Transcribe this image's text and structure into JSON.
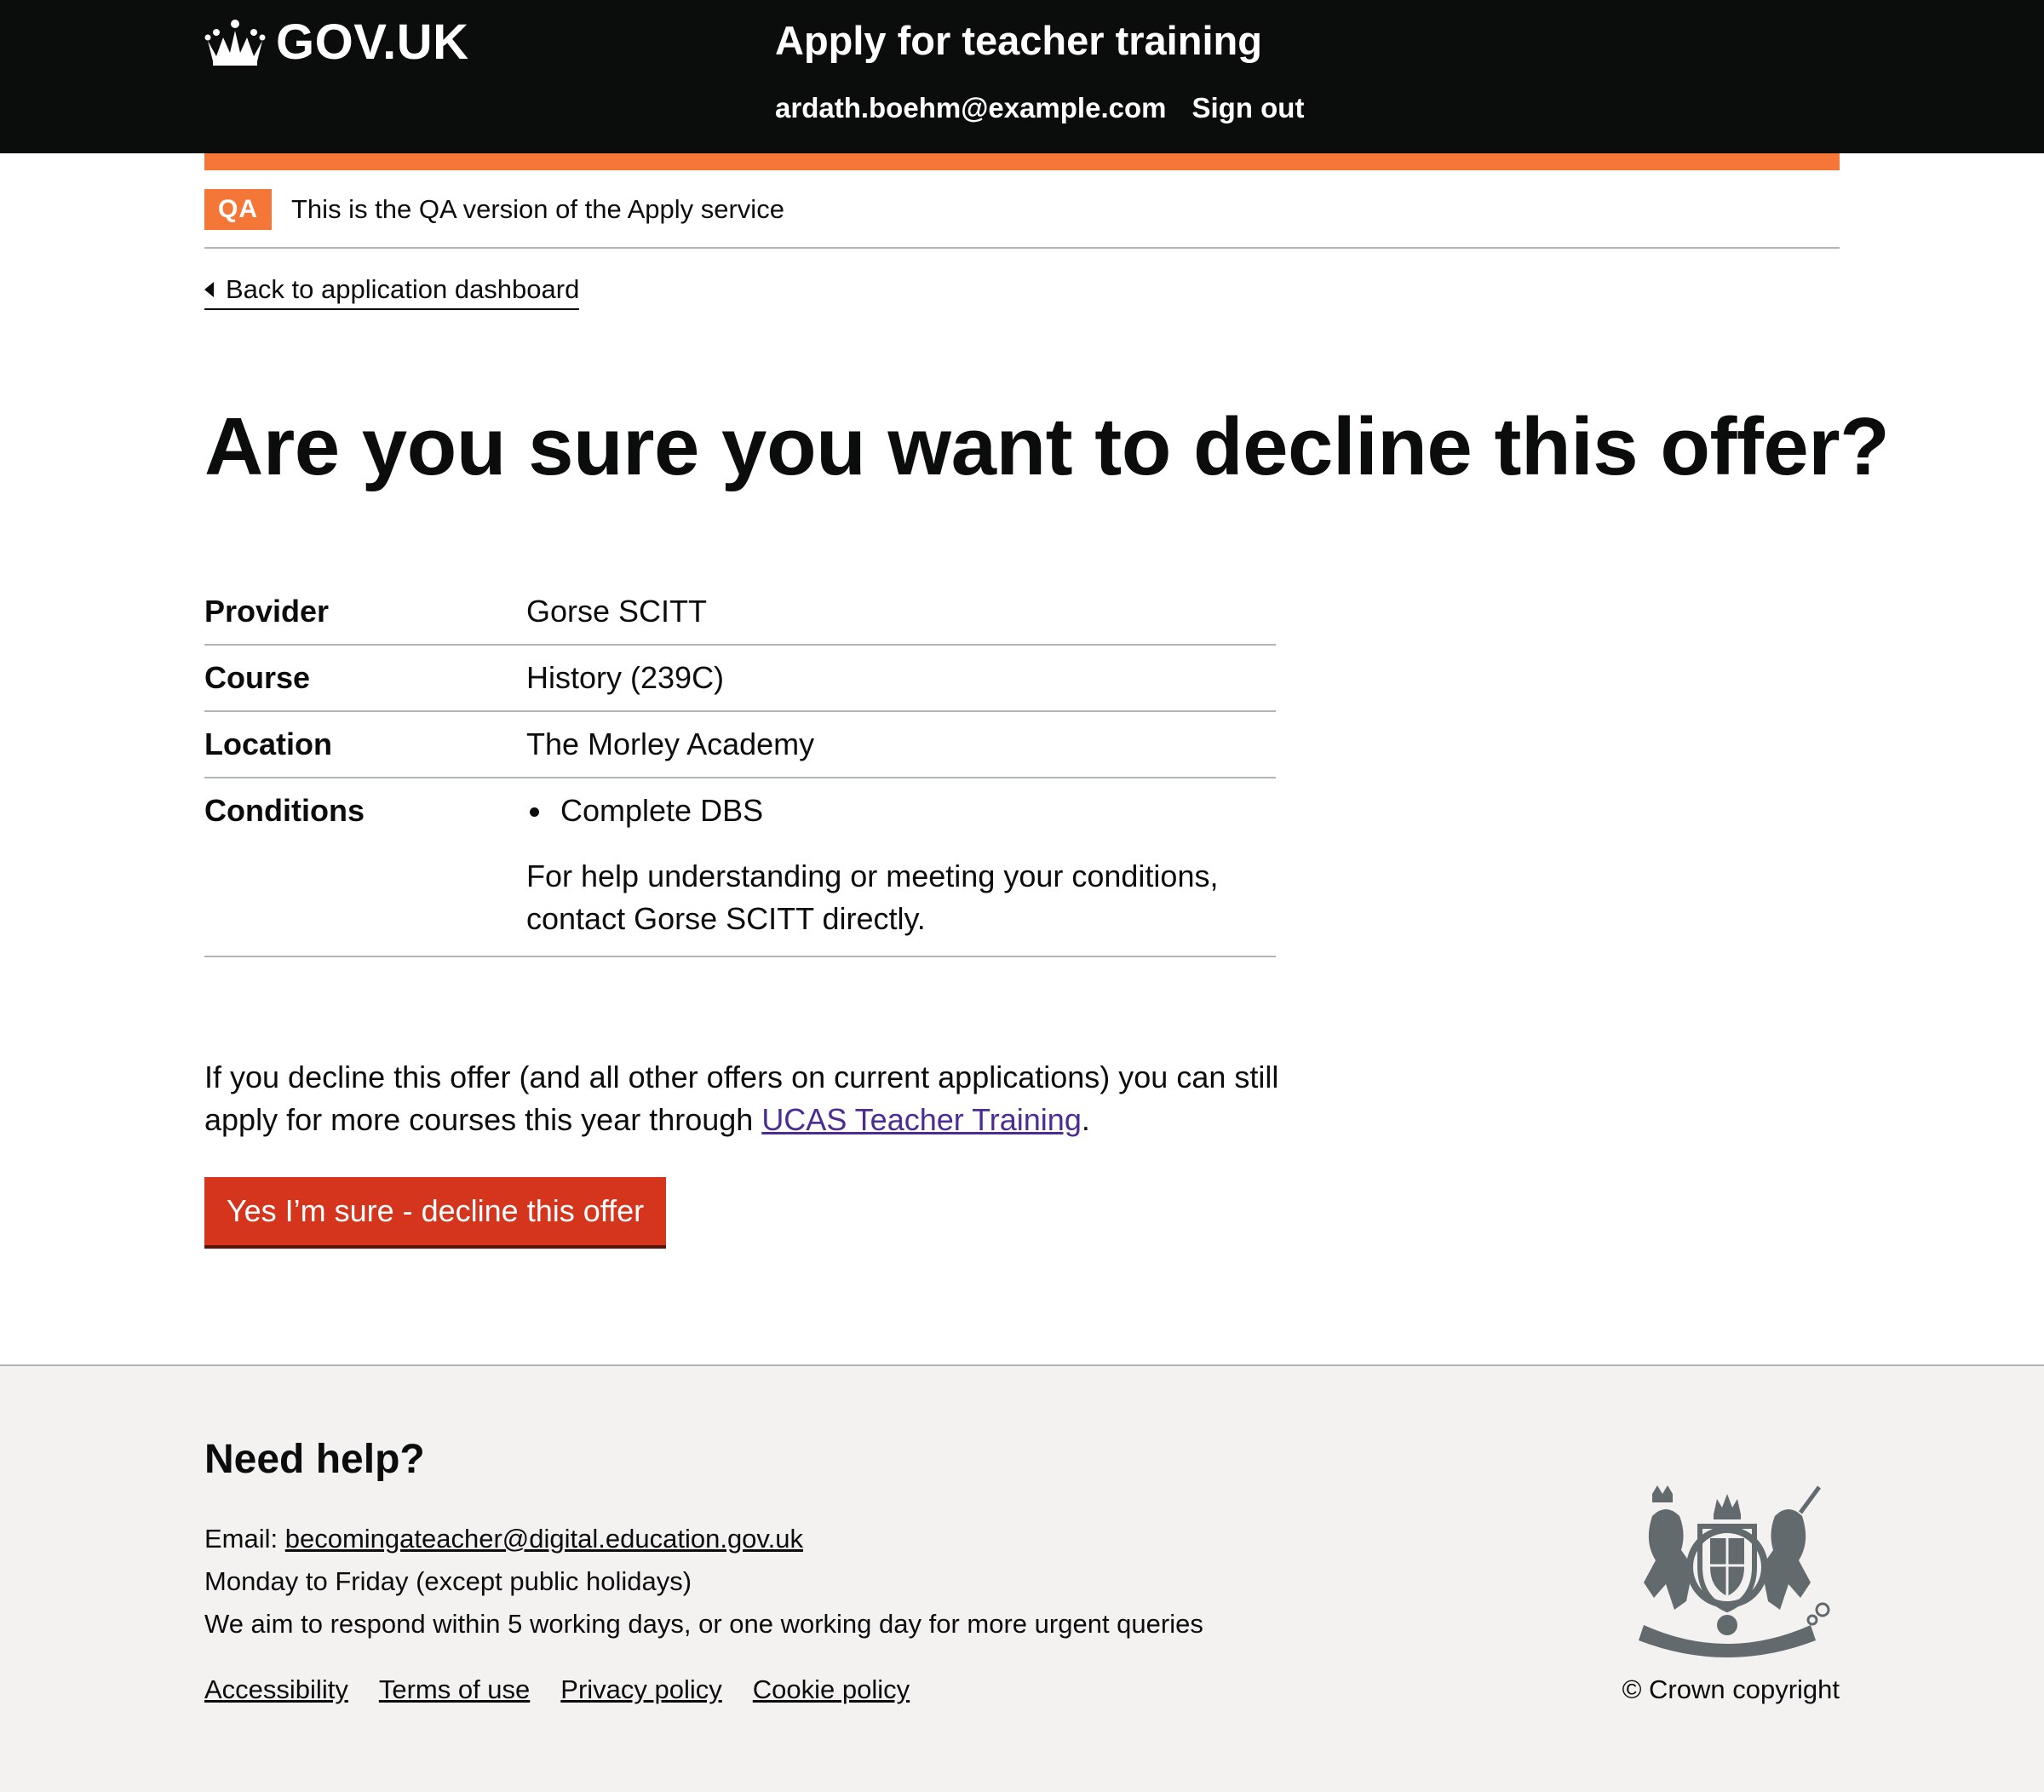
{
  "header": {
    "logo_text": "GOV.UK",
    "service_name": "Apply for teacher training",
    "user_email": "ardath.boehm@example.com",
    "sign_out": "Sign out"
  },
  "phase_banner": {
    "tag": "QA",
    "text": "This is the QA version of the Apply service"
  },
  "back_link": "Back to application dashboard",
  "heading": "Are you sure you want to decline this offer?",
  "summary": {
    "provider_key": "Provider",
    "provider_value": "Gorse SCITT",
    "course_key": "Course",
    "course_value": "History (239C)",
    "location_key": "Location",
    "location_value": "The Morley Academy",
    "conditions_key": "Conditions",
    "conditions_items": [
      "Complete DBS"
    ],
    "conditions_help": "For help understanding or meeting your conditions, contact Gorse SCITT directly."
  },
  "paragraph": {
    "text_before": "If you decline this offer (and all other offers on current applications) you can still apply for more courses this year through ",
    "link_text": "UCAS Teacher Training",
    "text_after": "."
  },
  "confirm_button": "Yes I’m sure - decline this offer",
  "footer": {
    "title": "Need help?",
    "email_label": "Email: ",
    "email_link": "becomingateacher@digital.education.gov.uk",
    "hours": "Monday to Friday (except public holidays)",
    "response": "We aim to respond within 5 working days, or one working day for more urgent queries",
    "links": [
      "Accessibility",
      "Terms of use",
      "Privacy policy",
      "Cookie policy"
    ],
    "copyright": "© Crown copyright"
  },
  "colors": {
    "header_bg": "#0b0c0c",
    "accent_orange": "#f47738",
    "button_red": "#d4351c",
    "link_purple": "#4c2c92",
    "footer_bg": "#f3f2f1"
  },
  "icons": [
    "crown-icon",
    "back-arrow-icon",
    "royal-crest-icon"
  ]
}
